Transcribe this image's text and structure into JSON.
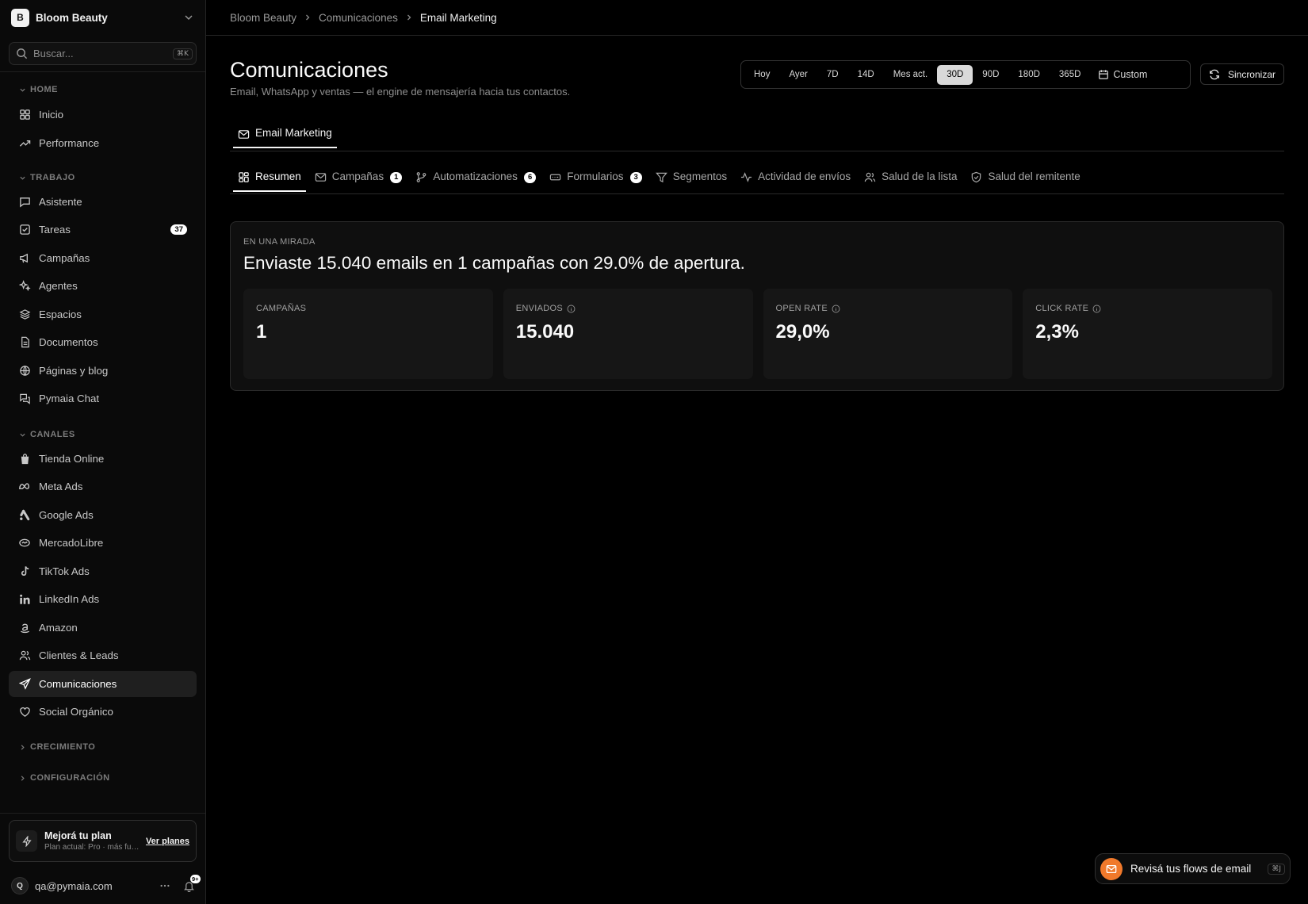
{
  "workspace": {
    "initial": "B",
    "name": "Bloom Beauty"
  },
  "search": {
    "placeholder": "Buscar...",
    "shortcut": "⌘K"
  },
  "sidebar": {
    "sections": {
      "home": "HOME",
      "trabajo": "TRABAJO",
      "canales": "CANALES",
      "crecimiento": "CRECIMIENTO",
      "configuracion": "CONFIGURACIÓN"
    },
    "items": {
      "inicio": "Inicio",
      "performance": "Performance",
      "asistente": "Asistente",
      "tareas": "Tareas",
      "tareas_badge": "37",
      "campanas": "Campañas",
      "agentes": "Agentes",
      "espacios": "Espacios",
      "documentos": "Documentos",
      "paginas": "Páginas y blog",
      "chat": "Pymaia Chat",
      "tienda": "Tienda Online",
      "meta": "Meta Ads",
      "google": "Google Ads",
      "mercadolibre": "MercadoLibre",
      "tiktok": "TikTok Ads",
      "linkedin": "LinkedIn Ads",
      "amazon": "Amazon",
      "clientes": "Clientes & Leads",
      "comunicaciones": "Comunicaciones",
      "social": "Social Orgánico"
    }
  },
  "upgrade": {
    "title": "Mejorá tu plan",
    "subtitle": "Plan actual: Pro · más func...",
    "link": "Ver planes"
  },
  "user": {
    "initial": "Q",
    "email": "qa@pymaia.com",
    "notifications": "9+"
  },
  "breadcrumb": [
    "Bloom Beauty",
    "Comunicaciones",
    "Email Marketing"
  ],
  "page": {
    "title": "Comunicaciones",
    "subtitle": "Email, WhatsApp y ventas — el engine de mensajería hacia tus contactos."
  },
  "ranges": {
    "options": [
      "Hoy",
      "Ayer",
      "7D",
      "14D",
      "Mes act.",
      "30D",
      "90D",
      "180D",
      "365D"
    ],
    "selected": "30D",
    "custom": "Custom"
  },
  "sync_label": "Sincronizar",
  "primary_tab": "Email Marketing",
  "subtabs": {
    "resumen": "Resumen",
    "campanas": "Campañas",
    "campanas_count": "1",
    "automatizaciones": "Automatizaciones",
    "automatizaciones_count": "6",
    "formularios": "Formularios",
    "formularios_count": "3",
    "segmentos": "Segmentos",
    "actividad": "Actividad de envíos",
    "salud_lista": "Salud de la lista",
    "salud_remitente": "Salud del remitente"
  },
  "glance": {
    "eyebrow": "EN UNA MIRADA",
    "headline": "Enviaste 15.040 emails en 1 campañas con 29.0% de apertura.",
    "kpis": [
      {
        "label": "CAMPAÑAS",
        "value": "1"
      },
      {
        "label": "ENVIADOS",
        "value": "15.040"
      },
      {
        "label": "OPEN RATE",
        "value": "29,0%"
      },
      {
        "label": "CLICK RATE",
        "value": "2,3%"
      }
    ]
  },
  "toast": {
    "text": "Revisá tus flows de email",
    "shortcut": "⌘J"
  },
  "colors": {
    "accent_orange": "#f0792b",
    "background": "#000000",
    "active_item": "#1f1f1f"
  }
}
